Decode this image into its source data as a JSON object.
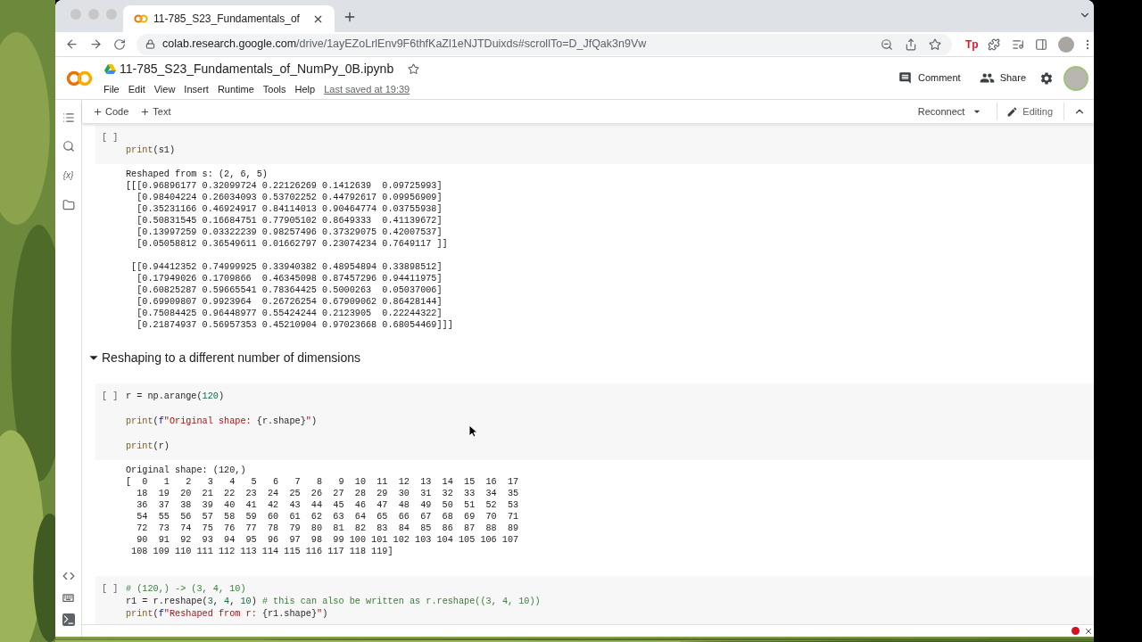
{
  "browser": {
    "tab": {
      "title": "11-785_S23_Fundamentals_of",
      "selected": true
    },
    "url": {
      "host": "colab.research.google.com",
      "path": "/drive/1ayEZoLrlEnv9F6thfKaZl1eNJTDuixds#scrollTo=D_JfQak3n9Vw"
    },
    "extension_badge": "Tp"
  },
  "notebook": {
    "title": "11-785_S23_Fundamentals_of_NumPy_0B.ipynb",
    "menu": [
      "File",
      "Edit",
      "View",
      "Insert",
      "Runtime",
      "Tools",
      "Help"
    ],
    "last_saved": "Last saved at 19:39",
    "actions": [
      "Comment",
      "Share"
    ],
    "toolbar": {
      "add_buttons": [
        "Code",
        "Text"
      ],
      "runtime": "Reconnect",
      "mode": "Editing"
    }
  },
  "sidebar": {
    "variables_glyph": "{x}"
  },
  "cells": [
    {
      "kind": "code",
      "run_label": "[ ]",
      "lines": [
        {
          "kind": "blank"
        },
        {
          "kind": "code",
          "tokens": [
            {
              "text": "print",
              "kind": "function"
            },
            {
              "text": "(s1)",
              "kind": "plain"
            }
          ]
        }
      ]
    },
    {
      "kind": "output",
      "groups": [
        {
          "lines": [
            "Reshaped from s: (2, 6, 5)",
            "[[[0.96896177 0.32099724 0.22126269 0.1412639  0.09725993]",
            "  [0.98404224 0.26034093 0.53702252 0.44792617 0.09956909]",
            "  [0.35231166 0.46924917 0.84114013 0.90464774 0.03755938]",
            "  [0.50831545 0.16684751 0.77905102 0.8649333  0.41139672]",
            "  [0.13997259 0.03322239 0.98257496 0.37329075 0.42007537]",
            "  [0.05058812 0.36549611 0.01662797 0.23074234 0.7649117 ]]"
          ]
        },
        {
          "lines": [
            " [[0.94412352 0.74999925 0.33940382 0.48954894 0.33898512]",
            "  [0.17949026 0.1709866  0.46345098 0.87457296 0.94411975]",
            "  [0.60825287 0.59665541 0.78364425 0.5000263  0.05037006]",
            "  [0.69909807 0.9923964  0.26726254 0.67909062 0.86428144]",
            "  [0.75084425 0.96448977 0.55424244 0.2123905  0.22244322]",
            "  [0.21874937 0.56957353 0.45210904 0.97023668 0.68054469]]]"
          ]
        }
      ]
    },
    {
      "kind": "heading",
      "text": "Reshaping to a different number of dimensions",
      "expanded": true
    },
    {
      "kind": "code",
      "run_label": "[ ]",
      "lines": [
        {
          "kind": "code",
          "tokens": [
            {
              "text": "r = np.arange(",
              "kind": "plain"
            },
            {
              "text": "120",
              "kind": "number"
            },
            {
              "text": ")",
              "kind": "plain"
            }
          ]
        },
        {
          "kind": "blank"
        },
        {
          "kind": "code",
          "tokens": [
            {
              "text": "print",
              "kind": "function"
            },
            {
              "text": "(",
              "kind": "plain"
            },
            {
              "text": "f",
              "kind": "keyword"
            },
            {
              "text": "\"Original shape: ",
              "kind": "string"
            },
            {
              "text": "{r.shape}",
              "kind": "plain"
            },
            {
              "text": "\"",
              "kind": "string"
            },
            {
              "text": ")",
              "kind": "plain"
            }
          ]
        },
        {
          "kind": "blank"
        },
        {
          "kind": "code",
          "tokens": [
            {
              "text": "print",
              "kind": "function"
            },
            {
              "text": "(r)",
              "kind": "plain"
            }
          ]
        }
      ]
    },
    {
      "kind": "output",
      "groups": [
        {
          "lines": [
            "Original shape: (120,)",
            "[  0   1   2   3   4   5   6   7   8   9  10  11  12  13  14  15  16  17",
            "  18  19  20  21  22  23  24  25  26  27  28  29  30  31  32  33  34  35",
            "  36  37  38  39  40  41  42  43  44  45  46  47  48  49  50  51  52  53",
            "  54  55  56  57  58  59  60  61  62  63  64  65  66  67  68  69  70  71",
            "  72  73  74  75  76  77  78  79  80  81  82  83  84  85  86  87  88  89",
            "  90  91  92  93  94  95  96  97  98  99 100 101 102 103 104 105 106 107",
            " 108 109 110 111 112 113 114 115 116 117 118 119]"
          ]
        }
      ]
    },
    {
      "kind": "code",
      "run_label": "[ ]",
      "lines": [
        {
          "kind": "code",
          "tokens": [
            {
              "text": "# (120,) -> (3, 4, 10)",
              "kind": "comment"
            }
          ]
        },
        {
          "kind": "code",
          "tokens": [
            {
              "text": "r1 = r.reshape(",
              "kind": "plain"
            },
            {
              "text": "3",
              "kind": "number"
            },
            {
              "text": ", ",
              "kind": "plain"
            },
            {
              "text": "4",
              "kind": "number"
            },
            {
              "text": ", ",
              "kind": "plain"
            },
            {
              "text": "10",
              "kind": "number"
            },
            {
              "text": ") ",
              "kind": "plain"
            },
            {
              "text": "# this can also be written as r.reshape((3, 4, 10))",
              "kind": "comment"
            }
          ]
        },
        {
          "kind": "code",
          "tokens": [
            {
              "text": "print",
              "kind": "function"
            },
            {
              "text": "(",
              "kind": "plain"
            },
            {
              "text": "f",
              "kind": "keyword"
            },
            {
              "text": "\"Reshaped from r: ",
              "kind": "string"
            },
            {
              "text": "{r1.shape}",
              "kind": "plain"
            },
            {
              "text": "\"",
              "kind": "string"
            },
            {
              "text": ")",
              "kind": "plain"
            }
          ]
        }
      ]
    }
  ]
}
